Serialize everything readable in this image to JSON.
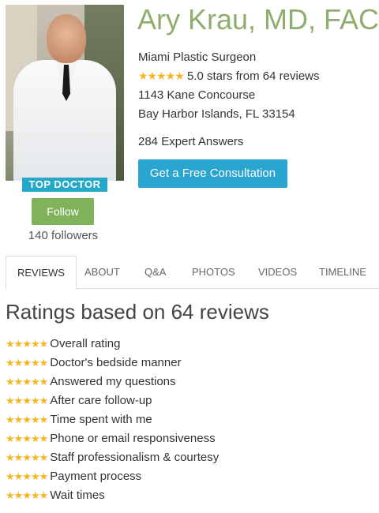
{
  "doctor": {
    "name": "Ary Krau, MD, FACS",
    "specialty": "Miami Plastic Surgeon",
    "rating_stars": "★★★★★",
    "rating_text": "5.0 stars from 64 reviews",
    "address_line1": "1143 Kane Concourse",
    "address_line2": "Bay Harbor Islands, FL 33154",
    "expert_answers": "284 Expert Answers",
    "badge": "TOP DOCTOR",
    "followers": "140 followers"
  },
  "buttons": {
    "follow": "Follow",
    "consultation": "Get a Free Consultation"
  },
  "tabs": [
    {
      "label": "REVIEWS"
    },
    {
      "label": "ABOUT"
    },
    {
      "label": "Q&A"
    },
    {
      "label": "PHOTOS"
    },
    {
      "label": "VIDEOS"
    },
    {
      "label": "TIMELINE"
    }
  ],
  "ratings": {
    "title": "Ratings based on 64 reviews",
    "stars": "★★★★★",
    "items": [
      {
        "label": "Overall rating"
      },
      {
        "label": "Doctor's bedside manner"
      },
      {
        "label": "Answered my questions"
      },
      {
        "label": "After care follow-up"
      },
      {
        "label": "Time spent with me"
      },
      {
        "label": "Phone or email responsiveness"
      },
      {
        "label": "Staff professionalism & courtesy"
      },
      {
        "label": "Payment process"
      },
      {
        "label": "Wait times"
      }
    ]
  },
  "colors": {
    "name_green": "#8fad6f",
    "follow_green": "#80b15b",
    "consult_blue": "#2aa5cf",
    "badge_blue": "#26a9c9",
    "star_gold": "#f5b521"
  }
}
